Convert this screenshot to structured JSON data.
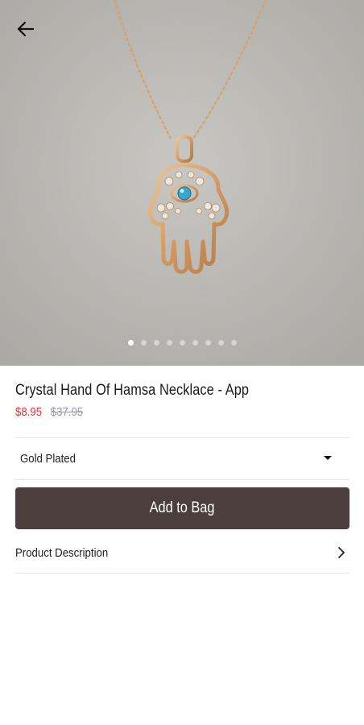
{
  "product": {
    "title": "Crystal Hand Of Hamsa Necklace - App",
    "sale_price": "$8.95",
    "original_price": "$37.95",
    "image_icon": "necklace-photo",
    "gallery": {
      "image_count": 9,
      "active_index": 0
    }
  },
  "nav": {
    "back_icon": "arrow-left-icon"
  },
  "variant": {
    "selected": "Gold Plated",
    "icon": "caret-down-icon"
  },
  "actions": {
    "add_to_bag": "Add to Bag",
    "button_color": "#4b3f3e"
  },
  "description": {
    "label": "Product Description",
    "icon": "chevron-right-icon"
  },
  "colors": {
    "sale_price": "#e0353f",
    "original_price": "#9a96ab"
  }
}
